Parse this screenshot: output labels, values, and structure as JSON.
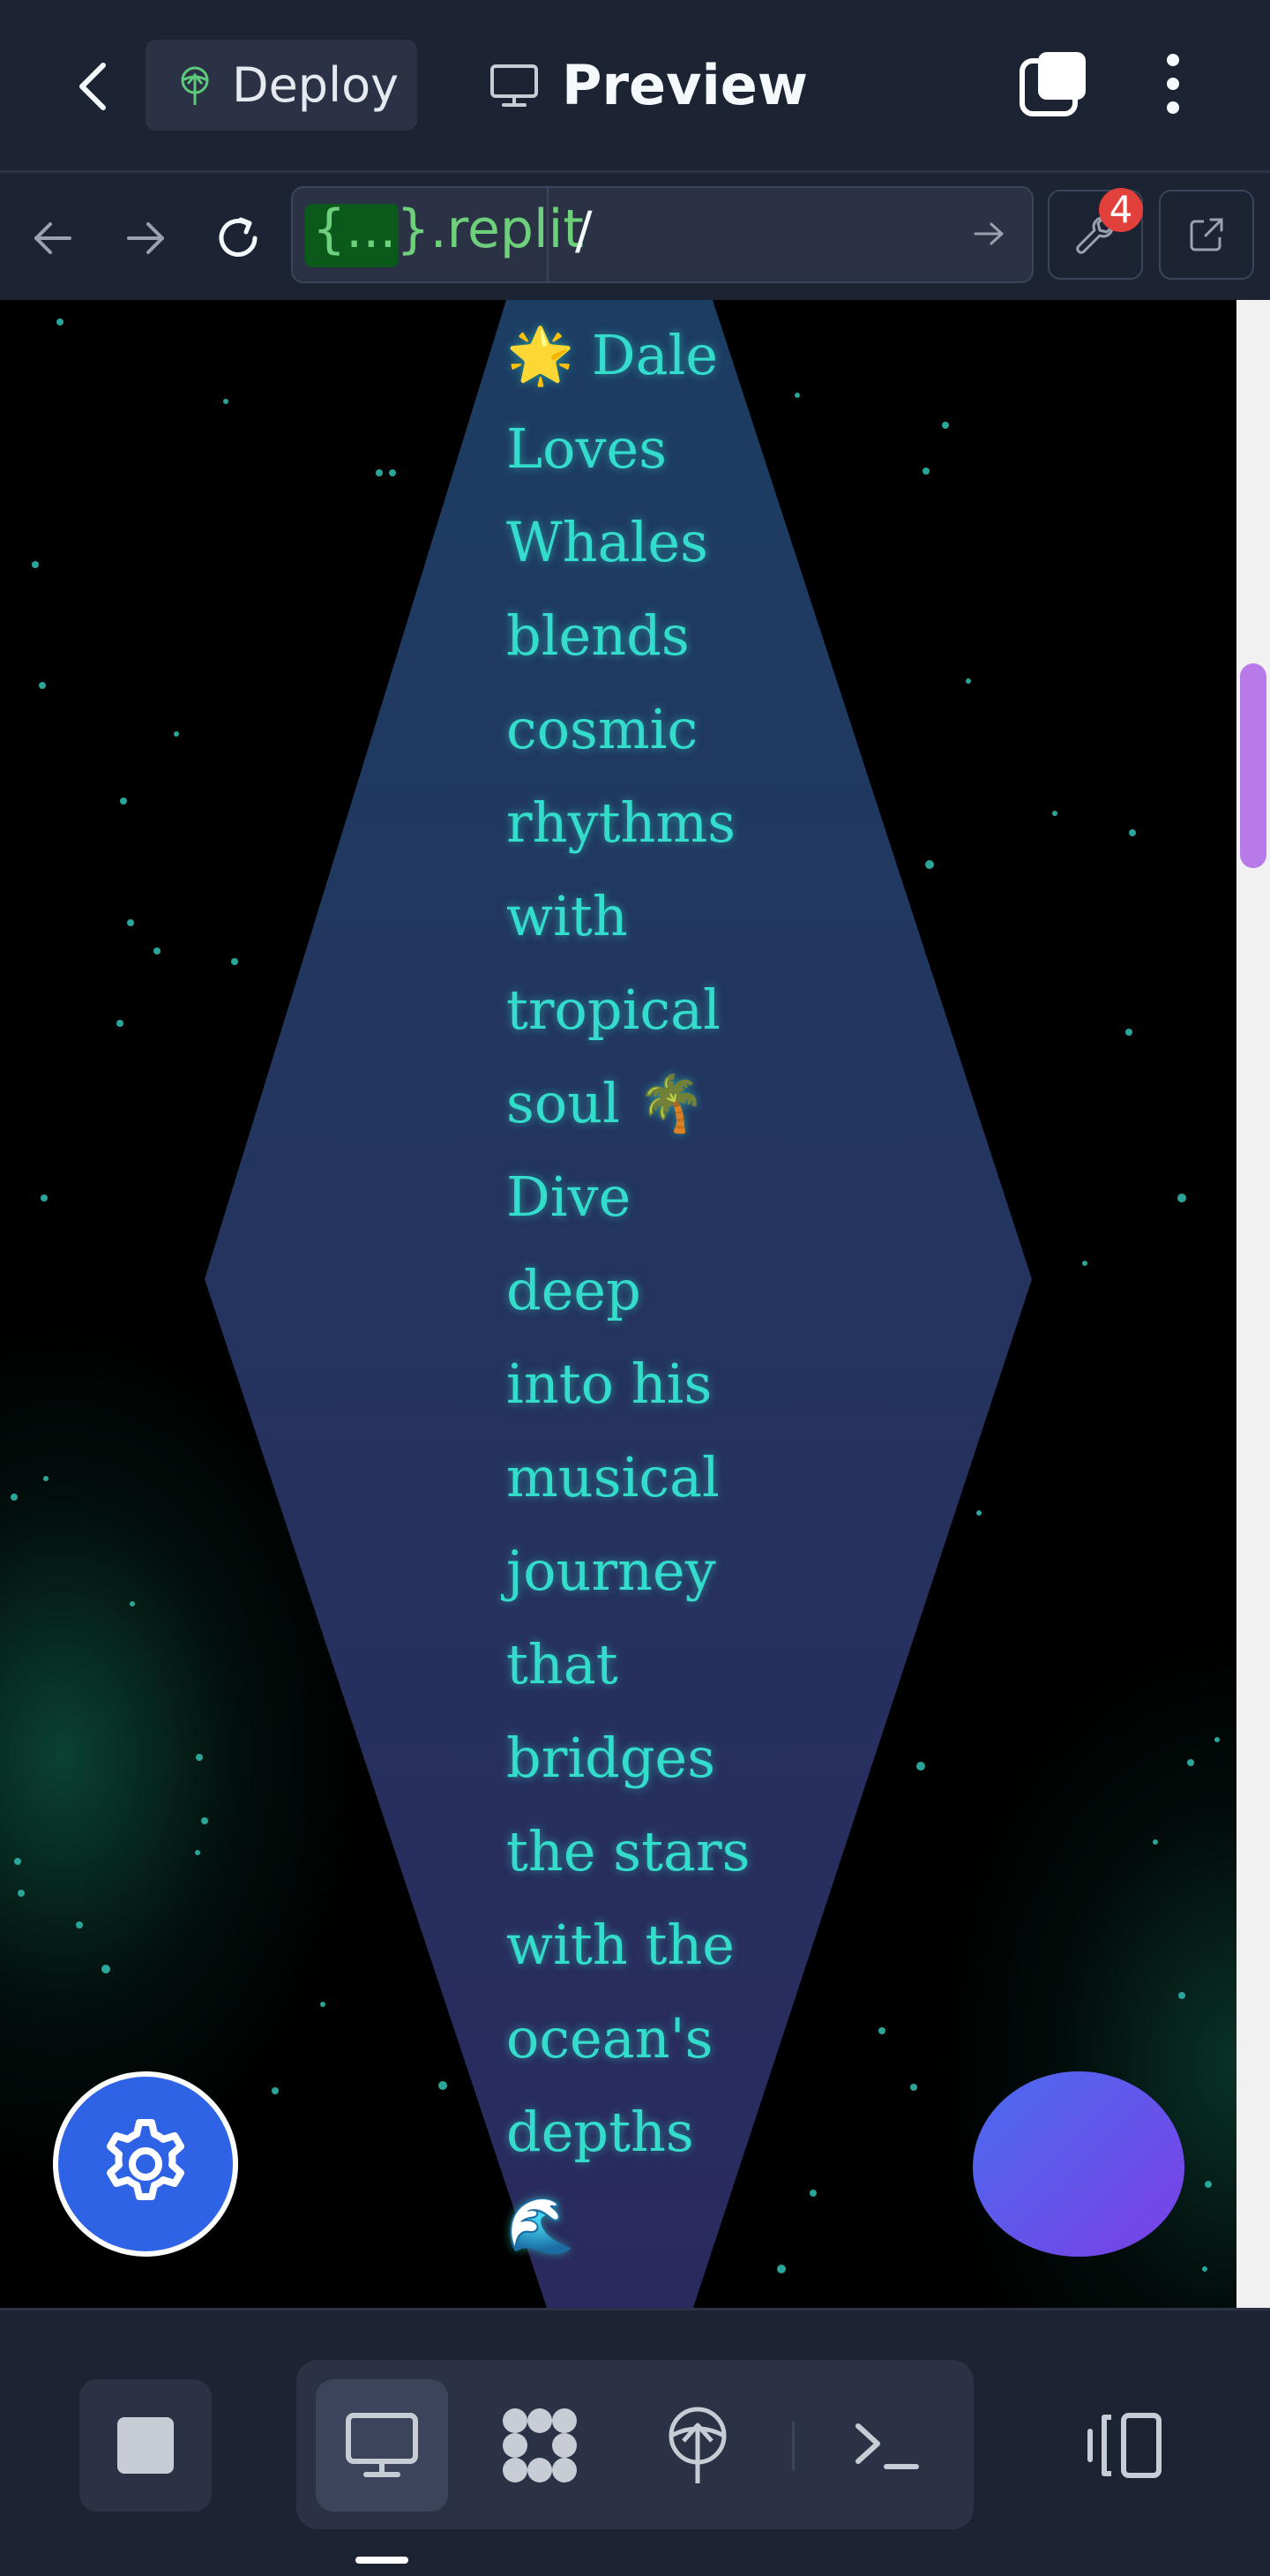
{
  "toolbar": {
    "deploy_label": "Deploy",
    "preview_label": "Preview",
    "icons": [
      "chevron-left-icon",
      "deploy-icon",
      "monitor-icon",
      "tabs-icon",
      "kebab-menu-icon"
    ]
  },
  "urlbar": {
    "host_badge": "{...}",
    "host_suffix": ".replit",
    "path": "/",
    "tools_badge_count": "4",
    "icons": [
      "arrow-left-icon",
      "arrow-right-icon",
      "refresh-icon",
      "arrow-go-icon",
      "wrench-icon",
      "external-link-icon"
    ]
  },
  "webview": {
    "text_lines": [
      "🌟 Dale",
      "Loves",
      "Whales",
      "blends",
      "cosmic",
      "rhythms",
      "with",
      "tropical",
      "soul 🌴",
      "Dive",
      "deep",
      "into his",
      "musical",
      "journey",
      "that",
      "bridges",
      "the stars",
      "with the",
      "ocean's",
      "depths",
      "🌊"
    ],
    "text_color": "#33dccb",
    "settings_fab_color": "#2f63e6"
  },
  "bottombar": {
    "icons": [
      "stop-icon",
      "monitor-icon",
      "workspace-icon",
      "deploy-icon",
      "terminal-icon",
      "layout-icon"
    ]
  }
}
